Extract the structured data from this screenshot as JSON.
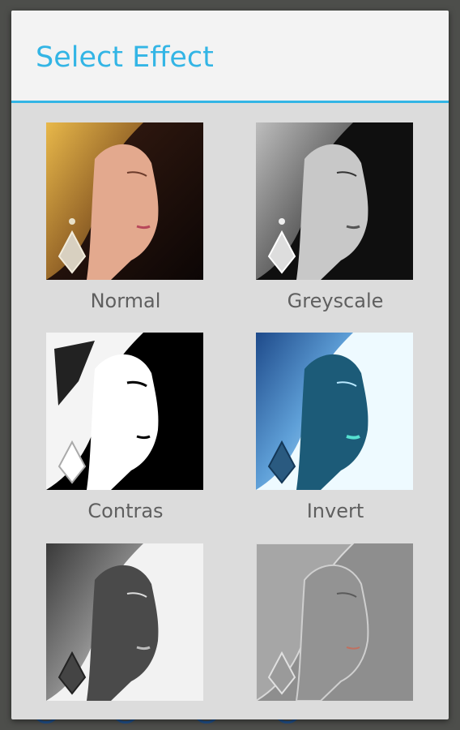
{
  "dialog": {
    "title": "Select Effect"
  },
  "effects": [
    {
      "label": "Normal",
      "style": "normal"
    },
    {
      "label": "Greyscale",
      "style": "greyscale"
    },
    {
      "label": "Contras",
      "style": "contrast"
    },
    {
      "label": "Invert",
      "style": "invert"
    },
    {
      "label": "",
      "style": "inverted-grey"
    },
    {
      "label": "",
      "style": "emboss"
    }
  ],
  "colors": {
    "accent": "#33b5e5",
    "dialog_bg": "#dcdcdc",
    "header_bg": "#f3f3f3",
    "label_text": "#5f5f5f"
  }
}
